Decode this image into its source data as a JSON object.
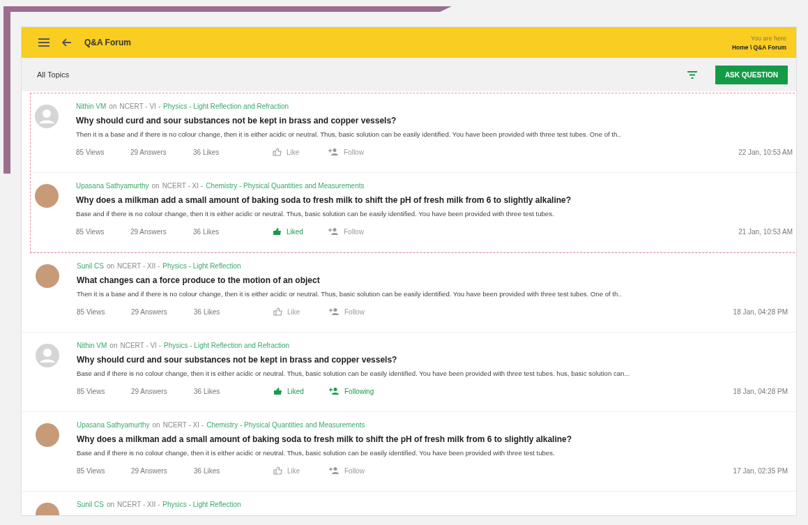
{
  "header": {
    "title": "Q&A Forum",
    "breadcrumb_label": "You are here",
    "breadcrumb": "Home \\ Q&A Forum"
  },
  "toolbar": {
    "label": "All Topics",
    "button": "ASK QUESTION"
  },
  "posts": [
    {
      "highlighted": true,
      "avatar": {
        "kind": "placeholder"
      },
      "author": "Nithin VM",
      "on": "on",
      "course": "NCERT - VI -",
      "topic": "Physics - Light Reflection and Refraction",
      "question": "Why should curd and sour substances not be kept in brass and copper vessels?",
      "excerpt": "Then it is a base and if there is no colour change, then it is either acidic or neutral. Thus, basic solution can be easily identified. You have been provided with three test tubes. One of th..",
      "views": "85 Views",
      "answers": "29 Answers",
      "likes": "36 Likes",
      "like": {
        "label": "Like",
        "selected": false
      },
      "follow": {
        "label": "Follow",
        "selected": false
      },
      "date": "22 Jan, 10:53 AM"
    },
    {
      "highlighted": true,
      "avatar": {
        "kind": "photo"
      },
      "author": "Upasana Sathyamurthy",
      "on": "on",
      "course": "NCERT - XI -",
      "topic": "Chemistry - Physical Quantities and Measurements",
      "question": "Why does a milkman add a small amount of baking soda to fresh milk to shift the pH of fresh milk from 6 to slightly alkaline?",
      "excerpt": "Base and if there is no colour change, then it is either acidic or neutral. Thus, basic solution can be easily identified. You have been provided with three test tubes.",
      "views": "85 Views",
      "answers": "29 Answers",
      "likes": "36 Likes",
      "like": {
        "label": "Liked",
        "selected": true
      },
      "follow": {
        "label": "Follow",
        "selected": false
      },
      "date": "21 Jan, 10:53 AM"
    },
    {
      "highlighted": false,
      "avatar": {
        "kind": "photo"
      },
      "author": "Sunil CS",
      "on": "on",
      "course": "NCERT - XII -",
      "topic": "Physics - Light Reflection",
      "question": "What changes can a force produce to the motion of an object",
      "excerpt": "Then it is a base and if there is no colour change, then it is either acidic or neutral. Thus, basic solution can be easily identified. You have been provided with three test tubes. One of th..",
      "views": "85 Views",
      "answers": "29 Answers",
      "likes": "36 Likes",
      "like": {
        "label": "Like",
        "selected": false
      },
      "follow": {
        "label": "Follow",
        "selected": false
      },
      "date": "18 Jan, 04:28 PM"
    },
    {
      "highlighted": false,
      "avatar": {
        "kind": "placeholder"
      },
      "author": "Nithin VM",
      "on": "on",
      "course": "NCERT - VI -",
      "topic": "Physics - Light Reflection and Refraction",
      "question": "Why should curd and sour substances not be kept in brass and copper vessels?",
      "excerpt": "Base and if there is no colour change, then it is either acidic or neutral. Thus, basic solution can be easily identified. You have been provided with three test tubes. hus, basic solution can...",
      "views": "85 Views",
      "answers": "29 Answers",
      "likes": "36 Likes",
      "like": {
        "label": "Liked",
        "selected": true
      },
      "follow": {
        "label": "Following",
        "selected": true
      },
      "date": "18 Jan, 04:28 PM"
    },
    {
      "highlighted": false,
      "avatar": {
        "kind": "photo"
      },
      "author": "Upasana Sathyamurthy",
      "on": "on",
      "course": "NCERT - XI -",
      "topic": "Chemistry - Physical Quantities and Measurements",
      "question": "Why does a milkman add a small amount of baking soda to fresh milk to shift the pH of fresh milk from 6 to slightly alkaline?",
      "excerpt": "Base and if there is no colour change, then it is either acidic or neutral. Thus, basic solution can be easily identified. You have been provided with three test tubes.",
      "views": "85 Views",
      "answers": "29 Answers",
      "likes": "36 Likes",
      "like": {
        "label": "Like",
        "selected": false
      },
      "follow": {
        "label": "Follow",
        "selected": false
      },
      "date": "17 Jan, 02:35 PM"
    },
    {
      "highlighted": false,
      "avatar": {
        "kind": "photo"
      },
      "author": "Sunil CS",
      "on": "on",
      "course": "NCERT - XII -",
      "topic": "Physics - Light Reflection"
    }
  ]
}
